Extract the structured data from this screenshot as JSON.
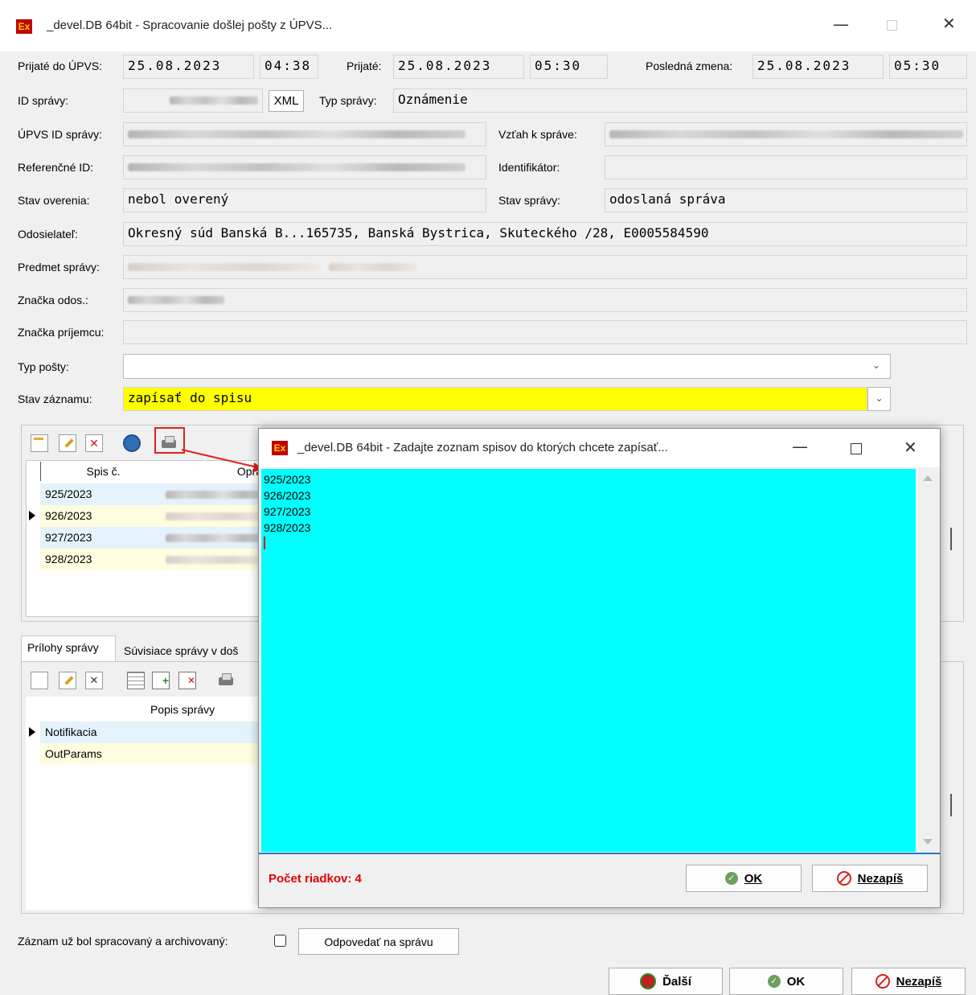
{
  "window": {
    "app_icon": "Ex",
    "title": "_devel.DB 64bit - Spracovanie došlej pošty z ÚPVS..."
  },
  "form": {
    "prijate_upvs_label": "Prijaté do ÚPVS:",
    "prijate_upvs_date": "25.08.2023",
    "prijate_upvs_time": "04:38",
    "prijate_label": "Prijaté:",
    "prijate_date": "25.08.2023",
    "prijate_time": "05:30",
    "posledna_zmena_label": "Posledná zmena:",
    "posledna_zmena_date": "25.08.2023",
    "posledna_zmena_time": "05:30",
    "id_spravy_label": "ID správy:",
    "xml_button": "XML",
    "typ_spravy_label": "Typ správy:",
    "typ_spravy_value": "Oznámenie",
    "upvs_id_label": "ÚPVS ID správy:",
    "vztah_label": "Vzťah k správe:",
    "referencne_id_label": "Referenčné ID:",
    "identifikator_label": "Identifikátor:",
    "stav_overenia_label": "Stav overenia:",
    "stav_overenia_value": "nebol overený",
    "stav_spravy_label": "Stav správy:",
    "stav_spravy_value": "odoslaná správa",
    "odosielatel_label": "Odosielateľ:",
    "odosielatel_value": "Okresný súd Banská B...165735, Banská Bystrica, Skuteckého /28, E0005584590",
    "predmet_label": "Predmet správy:",
    "znacka_odos_label": "Značka odos.:",
    "znacka_prijemcu_label": "Značka príjemcu:",
    "typ_posty_label": "Typ pošty:",
    "typ_posty_value": "",
    "stav_zaznamu_label": "Stav záznamu:",
    "stav_zaznamu_value": "zapísať do spisu"
  },
  "spisy_grid": {
    "columns": [
      "Spis č.",
      "Opra"
    ],
    "rows": [
      "925/2023",
      "926/2023",
      "927/2023",
      "928/2023"
    ]
  },
  "tabs": {
    "prilohy": "Prílohy správy",
    "suvisiace": "Súvisiace správy v doš"
  },
  "prilohy_grid": {
    "column": "Popis správy",
    "rows": [
      "Notifikacia",
      "OutParams"
    ]
  },
  "bottom": {
    "archived_label": "Záznam už bol spracovaný a archivovaný:",
    "odpovedat_button": "Odpovedať na správu",
    "dalsi_button": "Ďalší",
    "ok_button": "OK",
    "nezapis_button": "Nezapíš"
  },
  "dialog": {
    "app_icon": "Ex",
    "title": "_devel.DB 64bit - Zadajte zoznam spisov do ktorých chcete zapísať...",
    "lines": [
      "925/2023",
      "926/2023",
      "927/2023",
      "928/2023"
    ],
    "pocet_label": "Počet riadkov: 4",
    "ok_button": "OK",
    "nezapis_button": "Nezapíš",
    "bg_color": "#00ffff",
    "status_color": "#e00000"
  }
}
